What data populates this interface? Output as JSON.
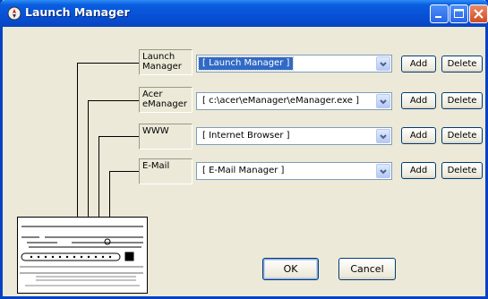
{
  "window": {
    "title": "Launch Manager"
  },
  "rows": [
    {
      "label": "Launch Manager",
      "label_line1": "Launch",
      "label_line2": "Manager",
      "value": "[  Launch Manager  ]",
      "selected": true,
      "add_label": "Add",
      "delete_label": "Delete"
    },
    {
      "label": "Acer eManager",
      "label_line1": "Acer",
      "label_line2": "eManager",
      "value": "[  c:\\acer\\eManager\\eManager.exe  ]",
      "selected": false,
      "add_label": "Add",
      "delete_label": "Delete"
    },
    {
      "label": "WWW",
      "label_line1": "WWW",
      "label_line2": "",
      "value": "[  Internet Browser  ]",
      "selected": false,
      "add_label": "Add",
      "delete_label": "Delete"
    },
    {
      "label": "E-Mail",
      "label_line1": "E-Mail",
      "label_line2": "",
      "value": "[  E-Mail Manager  ]",
      "selected": false,
      "add_label": "Add",
      "delete_label": "Delete"
    }
  ],
  "buttons": {
    "ok_label": "OK",
    "cancel_label": "Cancel"
  },
  "colors": {
    "titlebar": "#0750d6",
    "selection": "#316ac5",
    "dialog_bg": "#ece9d8"
  },
  "icons": {
    "title": "rocket-app-icon",
    "dropdown": "chevron-down-icon"
  }
}
